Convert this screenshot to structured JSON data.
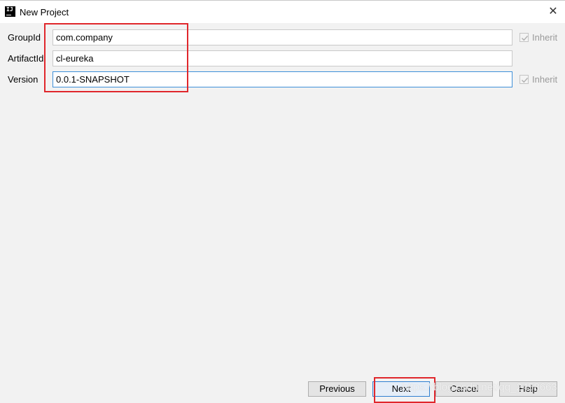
{
  "window": {
    "title": "New Project",
    "app_icon_text": "IJ",
    "close_glyph": "✕"
  },
  "form": {
    "group_id": {
      "label": "GroupId",
      "value": "com.company",
      "inherit_label": "Inherit",
      "inherit_checked": true
    },
    "artifact_id": {
      "label": "ArtifactId",
      "value": "cl-eureka"
    },
    "version": {
      "label": "Version",
      "value": "0.0.1-SNAPSHOT",
      "inherit_label": "Inherit",
      "inherit_checked": true
    }
  },
  "footer": {
    "previous_label": "Previous",
    "next_label": "Next",
    "cancel_label": "Cancel",
    "help_label": "Help"
  },
  "watermark": "https://blog.csdn.net/qq_2458663",
  "colors": {
    "highlight": "#e0262b",
    "focus_border": "#3d8fd8",
    "background": "#f2f2f2"
  }
}
